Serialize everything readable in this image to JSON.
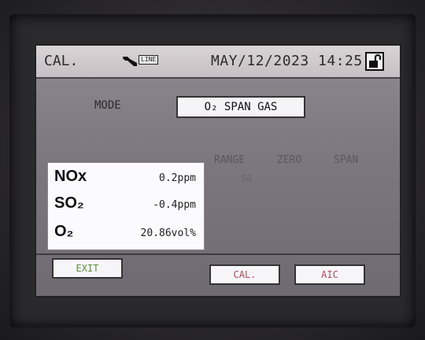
{
  "status_bar": {
    "mode": "CAL.",
    "line_badge": "LINE",
    "datetime": "MAY/12/2023 14:25"
  },
  "mode_row": {
    "label": "MODE",
    "value": "O₂ SPAN GAS"
  },
  "columns": {
    "range": "RANGE",
    "zero": "ZERO",
    "span": "SPAN",
    "range_value": "50"
  },
  "readings": [
    {
      "gas": "NOx",
      "value": "0.2ppm"
    },
    {
      "gas": "SO₂",
      "value": "-0.4ppm"
    },
    {
      "gas": "O₂",
      "value": "20.86vol%"
    }
  ],
  "buttons": {
    "exit": "EXIT",
    "cal": "CAL.",
    "aic": "AIC"
  },
  "colors": {
    "accent_green": "#7aa85c",
    "accent_red": "#c04848"
  },
  "icons": [
    "wrench-icon",
    "unlock-icon"
  ]
}
